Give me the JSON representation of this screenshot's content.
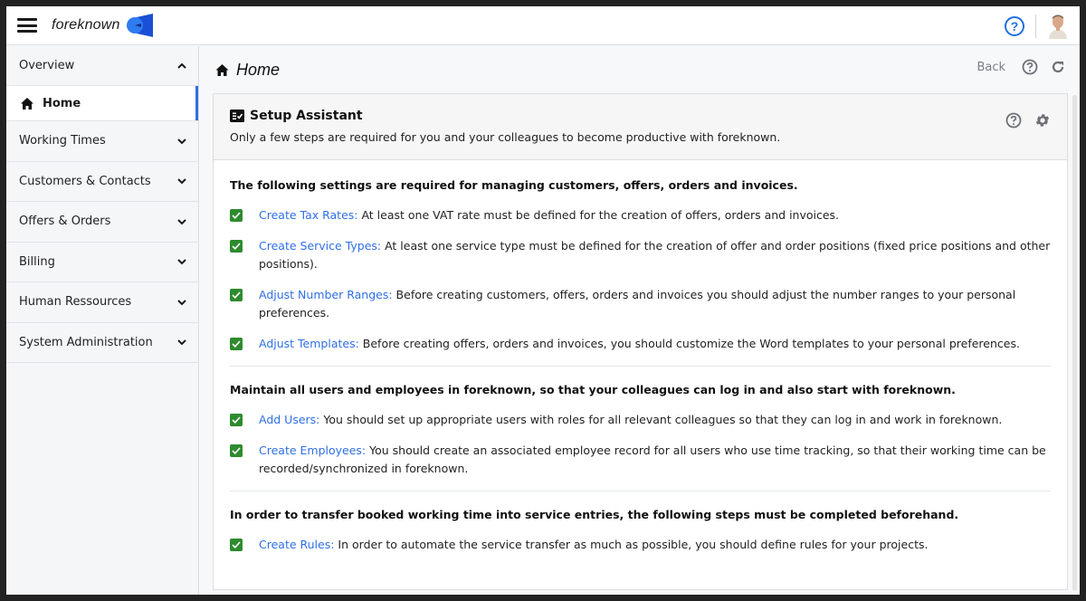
{
  "topbar": {
    "brand": "foreknown",
    "help_glyph": "?",
    "icons": {
      "menu": "hamburger-icon",
      "help": "help-circle-icon",
      "avatar": "user-avatar"
    }
  },
  "sidebar": {
    "items": [
      {
        "label": "Overview",
        "expanded": true
      },
      {
        "label": "Working Times",
        "expanded": false
      },
      {
        "label": "Customers & Contacts",
        "expanded": false
      },
      {
        "label": "Offers & Orders",
        "expanded": false
      },
      {
        "label": "Billing",
        "expanded": false
      },
      {
        "label": "Human Ressources",
        "expanded": false
      },
      {
        "label": "System Administration",
        "expanded": false
      }
    ],
    "active_sub": {
      "label": "Home",
      "icon": "home-icon"
    }
  },
  "page": {
    "title": "Home",
    "back_label": "Back",
    "colors": {
      "accent": "#2f6fe4",
      "check": "#2e8b2e",
      "help_blue": "#1f6fe0"
    }
  },
  "assistant": {
    "title": "Setup Assistant",
    "subtitle": "Only a few steps are required for you and your colleagues to become productive with foreknown.",
    "sections": [
      {
        "title": "The following settings are required for managing customers, offers, orders and invoices.",
        "tasks": [
          {
            "link": "Create Tax Rates:",
            "text": " At least one VAT rate must be defined for the creation of offers, orders and invoices.",
            "done": true
          },
          {
            "link": "Create Service Types:",
            "text": " At least one service type must be defined for the creation of offer and order positions (fixed price positions and other positions).",
            "done": true
          },
          {
            "link": "Adjust Number Ranges:",
            "text": " Before creating customers, offers, orders and invoices you should adjust the number ranges to your personal preferences.",
            "done": true
          },
          {
            "link": "Adjust Templates:",
            "text": " Before creating offers, orders and invoices, you should customize the Word templates to your personal preferences.",
            "done": true
          }
        ]
      },
      {
        "title": "Maintain all users and employees in foreknown, so that your colleagues can log in and also start with foreknown.",
        "tasks": [
          {
            "link": "Add Users:",
            "text": " You should set up appropriate users with roles for all relevant colleagues so that they can log in and work in foreknown.",
            "done": true
          },
          {
            "link": "Create Employees:",
            "text": " You should create an associated employee record for all users who use time tracking, so that their working time can be recorded/synchronized in foreknown.",
            "done": true
          }
        ]
      },
      {
        "title": "In order to transfer booked working time into service entries, the following steps must be completed beforehand.",
        "tasks": [
          {
            "link": "Create Rules:",
            "text": " In order to automate the service transfer as much as possible, you should define rules for your projects.",
            "done": true
          }
        ]
      }
    ]
  }
}
